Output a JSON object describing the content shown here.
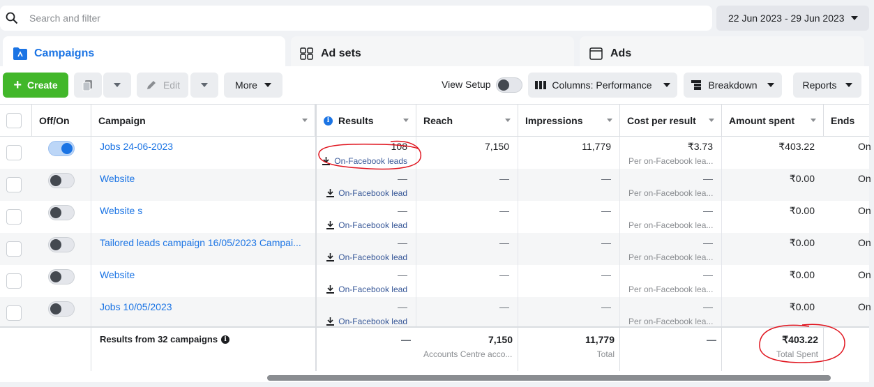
{
  "search": {
    "placeholder": "Search and filter"
  },
  "date_range": "22 Jun 2023 - 29 Jun 2023",
  "tabs": [
    {
      "label": "Campaigns"
    },
    {
      "label": "Ad sets"
    },
    {
      "label": "Ads"
    }
  ],
  "toolbar": {
    "create": "Create",
    "edit": "Edit",
    "more": "More",
    "view_setup": "View Setup",
    "columns": "Columns: Performance",
    "breakdown": "Breakdown",
    "reports": "Reports"
  },
  "headers": {
    "offon": "Off/On",
    "campaign": "Campaign",
    "results": "Results",
    "reach": "Reach",
    "impressions": "Impressions",
    "cpr": "Cost per result",
    "amount": "Amount spent",
    "ends": "Ends"
  },
  "rows": [
    {
      "on": true,
      "name": "Jobs 24-06-2023",
      "results": "108",
      "result_type": "On-Facebook leads",
      "reach": "7,150",
      "impressions": "11,779",
      "cpr": "₹3.73",
      "cpr_sub": "Per on-Facebook lea...",
      "amount": "₹403.22",
      "ends": "On"
    },
    {
      "on": false,
      "name": "Website",
      "results": "—",
      "result_type": "On-Facebook lead",
      "reach": "—",
      "impressions": "—",
      "cpr": "—",
      "cpr_sub": "Per on-Facebook lea...",
      "amount": "₹0.00",
      "ends": "On"
    },
    {
      "on": false,
      "name": "Website s",
      "results": "—",
      "result_type": "On-Facebook lead",
      "reach": "—",
      "impressions": "—",
      "cpr": "—",
      "cpr_sub": "Per on-Facebook lea...",
      "amount": "₹0.00",
      "ends": "On"
    },
    {
      "on": false,
      "name": "Tailored leads campaign 16/05/2023 Campai...",
      "results": "—",
      "result_type": "On-Facebook lead",
      "reach": "—",
      "impressions": "—",
      "cpr": "—",
      "cpr_sub": "Per on-Facebook lea...",
      "amount": "₹0.00",
      "ends": "On"
    },
    {
      "on": false,
      "name": "Website",
      "results": "—",
      "result_type": "On-Facebook lead",
      "reach": "—",
      "impressions": "—",
      "cpr": "—",
      "cpr_sub": "Per on-Facebook lea...",
      "amount": "₹0.00",
      "ends": "On"
    },
    {
      "on": false,
      "name": "Jobs 10/05/2023",
      "results": "—",
      "result_type": "On-Facebook lead",
      "reach": "—",
      "impressions": "—",
      "cpr": "—",
      "cpr_sub": "Per on-Facebook lea...",
      "amount": "₹0.00",
      "ends": "On"
    }
  ],
  "totals": {
    "label": "Results from 32 campaigns",
    "results": "—",
    "reach": "7,150",
    "reach_sub": "Accounts Centre acco...",
    "impressions": "11,779",
    "impressions_sub": "Total",
    "cpr": "—",
    "amount": "₹403.22",
    "amount_sub": "Total Spent"
  },
  "colors": {
    "accent": "#1b74e4",
    "create": "#42b72a",
    "annotation": "#e0141e",
    "link": "#385898"
  }
}
